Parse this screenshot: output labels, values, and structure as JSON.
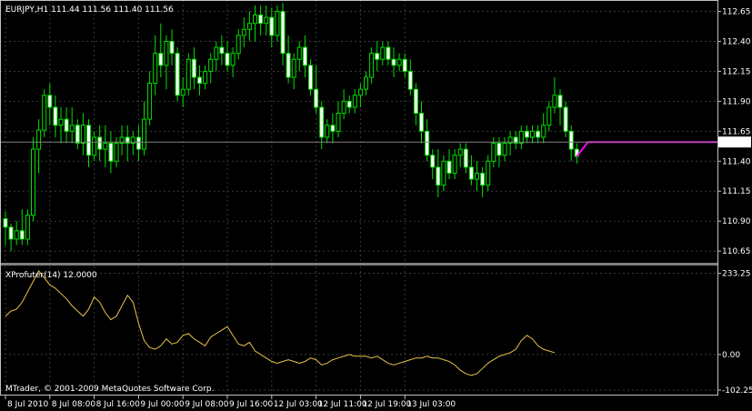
{
  "window": {
    "symbol_header": "EURJPY,H1  111.44 111.56 111.40 111.56",
    "indicator_header": "XProfuter(14) 12.0000",
    "copyright": "MTrader, © 2001-2009 MetaQuotes Software Corp."
  },
  "colors": {
    "background": "#000000",
    "grid": "#3a3a3a",
    "axis": "#c0c0c0",
    "bull_body": "#000000",
    "bear_body": "#ffffff",
    "wick": "#00e000",
    "indicator_line": "#e6c34a",
    "future_line": "#ff00ff",
    "price_line": "#808080",
    "current_price_bg": "#ffffff",
    "current_price_fg": "#000000"
  },
  "chart_data": [
    {
      "type": "candlestick",
      "series_name": "EURJPY,H1",
      "price_axis_ticks": [
        "112.65",
        "112.40",
        "112.15",
        "111.90",
        "111.65",
        "111.40",
        "111.15",
        "110.90",
        "110.65"
      ],
      "ylim": [
        110.56,
        112.73
      ],
      "current_price": 111.56,
      "current_price_label": "111.56",
      "candles": [
        [
          110.92,
          110.98,
          110.7,
          110.85
        ],
        [
          110.85,
          110.88,
          110.65,
          110.75
        ],
        [
          110.75,
          110.9,
          110.7,
          110.82
        ],
        [
          110.82,
          111.0,
          110.7,
          110.75
        ],
        [
          110.75,
          111.0,
          110.7,
          110.95
        ],
        [
          110.95,
          111.6,
          110.9,
          111.5
        ],
        [
          111.5,
          111.75,
          111.3,
          111.66
        ],
        [
          111.66,
          112.0,
          111.6,
          111.95
        ],
        [
          111.95,
          112.05,
          111.7,
          111.85
        ],
        [
          111.85,
          111.95,
          111.6,
          111.7
        ],
        [
          111.7,
          111.85,
          111.55,
          111.75
        ],
        [
          111.75,
          111.85,
          111.55,
          111.65
        ],
        [
          111.65,
          111.85,
          111.55,
          111.7
        ],
        [
          111.7,
          111.75,
          111.5,
          111.55
        ],
        [
          111.55,
          111.8,
          111.45,
          111.7
        ],
        [
          111.7,
          111.75,
          111.35,
          111.45
        ],
        [
          111.45,
          111.65,
          111.4,
          111.6
        ],
        [
          111.6,
          111.7,
          111.4,
          111.5
        ],
        [
          111.5,
          111.7,
          111.35,
          111.55
        ],
        [
          111.55,
          111.65,
          111.3,
          111.4
        ],
        [
          111.4,
          111.6,
          111.35,
          111.55
        ],
        [
          111.55,
          111.7,
          111.45,
          111.6
        ],
        [
          111.6,
          111.7,
          111.4,
          111.55
        ],
        [
          111.55,
          111.65,
          111.45,
          111.6
        ],
        [
          111.6,
          111.7,
          111.4,
          111.5
        ],
        [
          111.5,
          111.9,
          111.45,
          111.75
        ],
        [
          111.75,
          112.15,
          111.7,
          112.05
        ],
        [
          112.05,
          112.45,
          111.95,
          112.3
        ],
        [
          112.3,
          112.55,
          112.1,
          112.2
        ],
        [
          112.2,
          112.45,
          112.0,
          112.4
        ],
        [
          112.4,
          112.5,
          112.2,
          112.3
        ],
        [
          112.3,
          112.35,
          111.9,
          111.95
        ],
        [
          111.95,
          112.1,
          111.85,
          112.0
        ],
        [
          112.0,
          112.3,
          111.95,
          112.25
        ],
        [
          112.25,
          112.35,
          112.0,
          112.1
        ],
        [
          112.1,
          112.2,
          111.95,
          112.05
        ],
        [
          112.05,
          112.2,
          112.0,
          112.15
        ],
        [
          112.15,
          112.3,
          112.05,
          112.25
        ],
        [
          112.25,
          112.4,
          112.15,
          112.35
        ],
        [
          112.35,
          112.45,
          112.2,
          112.3
        ],
        [
          112.3,
          112.4,
          112.15,
          112.2
        ],
        [
          112.2,
          112.35,
          112.1,
          112.3
        ],
        [
          112.3,
          112.5,
          112.25,
          112.45
        ],
        [
          112.45,
          112.6,
          112.35,
          112.5
        ],
        [
          112.5,
          112.65,
          112.4,
          112.55
        ],
        [
          112.55,
          112.7,
          112.4,
          112.62
        ],
        [
          112.62,
          112.7,
          112.45,
          112.55
        ],
        [
          112.55,
          112.7,
          112.45,
          112.6
        ],
        [
          112.6,
          112.68,
          112.35,
          112.45
        ],
        [
          112.45,
          112.7,
          112.4,
          112.65
        ],
        [
          112.65,
          112.72,
          112.2,
          112.3
        ],
        [
          112.3,
          112.45,
          112.05,
          112.1
        ],
        [
          112.1,
          112.3,
          112.0,
          112.25
        ],
        [
          112.25,
          112.4,
          112.15,
          112.35
        ],
        [
          112.35,
          112.45,
          112.1,
          112.2
        ],
        [
          112.2,
          112.25,
          111.95,
          112.0
        ],
        [
          112.0,
          112.2,
          111.8,
          111.85
        ],
        [
          111.85,
          111.9,
          111.5,
          111.6
        ],
        [
          111.6,
          111.75,
          111.55,
          111.7
        ],
        [
          111.7,
          111.8,
          111.55,
          111.65
        ],
        [
          111.65,
          111.9,
          111.6,
          111.8
        ],
        [
          111.8,
          112.0,
          111.75,
          111.9
        ],
        [
          111.9,
          111.95,
          111.8,
          111.85
        ],
        [
          111.85,
          112.0,
          111.8,
          111.95
        ],
        [
          111.95,
          112.05,
          111.85,
          112.0
        ],
        [
          112.0,
          112.15,
          111.95,
          112.1
        ],
        [
          112.1,
          112.35,
          112.05,
          112.3
        ],
        [
          112.3,
          112.4,
          112.15,
          112.25
        ],
        [
          112.25,
          112.4,
          112.2,
          112.35
        ],
        [
          112.35,
          112.4,
          112.2,
          112.25
        ],
        [
          112.25,
          112.35,
          112.1,
          112.2
        ],
        [
          112.2,
          112.3,
          112.15,
          112.25
        ],
        [
          112.25,
          112.3,
          112.1,
          112.15
        ],
        [
          112.15,
          112.25,
          111.95,
          112.0
        ],
        [
          112.0,
          112.05,
          111.7,
          111.8
        ],
        [
          111.8,
          111.9,
          111.55,
          111.65
        ],
        [
          111.65,
          111.75,
          111.4,
          111.45
        ],
        [
          111.45,
          111.5,
          111.25,
          111.35
        ],
        [
          111.35,
          111.5,
          111.1,
          111.2
        ],
        [
          111.2,
          111.45,
          111.15,
          111.4
        ],
        [
          111.4,
          111.5,
          111.25,
          111.3
        ],
        [
          111.3,
          111.5,
          111.25,
          111.45
        ],
        [
          111.45,
          111.55,
          111.35,
          111.5
        ],
        [
          111.5,
          111.55,
          111.3,
          111.35
        ],
        [
          111.35,
          111.45,
          111.2,
          111.25
        ],
        [
          111.25,
          111.4,
          111.15,
          111.3
        ],
        [
          111.3,
          111.35,
          111.1,
          111.2
        ],
        [
          111.2,
          111.45,
          111.15,
          111.4
        ],
        [
          111.4,
          111.6,
          111.35,
          111.55
        ],
        [
          111.55,
          111.6,
          111.35,
          111.45
        ],
        [
          111.45,
          111.6,
          111.4,
          111.55
        ],
        [
          111.55,
          111.65,
          111.45,
          111.6
        ],
        [
          111.6,
          111.65,
          111.5,
          111.55
        ],
        [
          111.55,
          111.7,
          111.5,
          111.65
        ],
        [
          111.65,
          111.7,
          111.55,
          111.6
        ],
        [
          111.6,
          111.7,
          111.55,
          111.65
        ],
        [
          111.65,
          111.7,
          111.55,
          111.6
        ],
        [
          111.6,
          111.8,
          111.55,
          111.7
        ],
        [
          111.7,
          111.9,
          111.65,
          111.85
        ],
        [
          111.85,
          112.1,
          111.8,
          111.95
        ],
        [
          111.95,
          112.0,
          111.7,
          111.85
        ],
        [
          111.85,
          111.9,
          111.6,
          111.65
        ],
        [
          111.65,
          111.7,
          111.4,
          111.5
        ],
        [
          111.5,
          111.55,
          111.38,
          111.44
        ]
      ],
      "future_line": [
        [
          103,
          111.44
        ],
        [
          104,
          111.5
        ],
        [
          105,
          111.56
        ],
        [
          106,
          111.56
        ],
        [
          107,
          111.56
        ],
        [
          108,
          111.56
        ],
        [
          109,
          111.56
        ],
        [
          110,
          111.56
        ],
        [
          111,
          111.56
        ],
        [
          112,
          111.56
        ],
        [
          113,
          111.56
        ],
        [
          114,
          111.56
        ],
        [
          115,
          111.56
        ],
        [
          116,
          111.56
        ],
        [
          117,
          111.56
        ],
        [
          118,
          111.56
        ],
        [
          119,
          111.56
        ],
        [
          120,
          111.56
        ],
        [
          121,
          111.56
        ],
        [
          122,
          111.56
        ],
        [
          123,
          111.56
        ],
        [
          124,
          111.56
        ],
        [
          125,
          111.56
        ],
        [
          126,
          111.56
        ],
        [
          127,
          111.56
        ],
        [
          128,
          111.56
        ],
        [
          129,
          111.56
        ],
        [
          130,
          111.56
        ],
        [
          131,
          111.56
        ],
        [
          132,
          111.56
        ],
        [
          133,
          111.56
        ],
        [
          134,
          111.56
        ],
        [
          135,
          111.56
        ],
        [
          136,
          111.56
        ],
        [
          137,
          111.56
        ],
        [
          138,
          111.56
        ],
        [
          139,
          111.56
        ],
        [
          140,
          111.56
        ],
        [
          141,
          111.56
        ],
        [
          142,
          111.56
        ],
        [
          143,
          111.56
        ],
        [
          144,
          111.56
        ],
        [
          145,
          111.56
        ],
        [
          146,
          111.56
        ],
        [
          147,
          111.56
        ],
        [
          148,
          111.56
        ],
        [
          149,
          111.56
        ],
        [
          150,
          111.56
        ],
        [
          151,
          111.56
        ],
        [
          152,
          111.56
        ],
        [
          153,
          111.56
        ],
        [
          154,
          111.56
        ],
        [
          155,
          111.56
        ],
        [
          156,
          111.56
        ],
        [
          157,
          111.56
        ],
        [
          158,
          111.56
        ],
        [
          159,
          111.56
        ],
        [
          160,
          111.56
        ]
      ]
    },
    {
      "type": "line",
      "series_name": "XProfuter(14)",
      "indicator_axis_ticks": [
        "233.25",
        "0.00",
        "-102.25"
      ],
      "tick_values": [
        233.25,
        0,
        -102.25
      ],
      "ylim": [
        -110,
        245
      ],
      "values": [
        110,
        125,
        130,
        150,
        180,
        210,
        240,
        220,
        200,
        190,
        175,
        160,
        140,
        125,
        110,
        130,
        165,
        150,
        120,
        100,
        110,
        140,
        170,
        150,
        90,
        40,
        20,
        15,
        25,
        45,
        30,
        35,
        55,
        60,
        45,
        35,
        25,
        50,
        60,
        70,
        80,
        55,
        30,
        25,
        35,
        10,
        0,
        -10,
        -20,
        -25,
        -20,
        -15,
        -20,
        -25,
        -20,
        -10,
        -15,
        -30,
        -25,
        -15,
        -10,
        -5,
        0,
        -5,
        -5,
        -5,
        -10,
        -5,
        -15,
        -25,
        -30,
        -25,
        -20,
        -15,
        -10,
        -10,
        -5,
        -10,
        -10,
        -15,
        -20,
        -30,
        -45,
        -55,
        -60,
        -55,
        -40,
        -25,
        -15,
        -5,
        0,
        5,
        15,
        40,
        55,
        45,
        25,
        15,
        10,
        5
      ]
    }
  ],
  "time_axis": {
    "labels": [
      "8 Jul 2010",
      "8 Jul 08:00",
      "8 Jul 16:00",
      "9 Jul 00:00",
      "9 Jul 08:00",
      "9 Jul 16:00",
      "12 Jul 03:00",
      "12 Jul 11:00",
      "12 Jul 19:00",
      "13 Jul 03:00"
    ],
    "bar_index": [
      0,
      8,
      16,
      24,
      32,
      40,
      48,
      56,
      64,
      72
    ]
  }
}
